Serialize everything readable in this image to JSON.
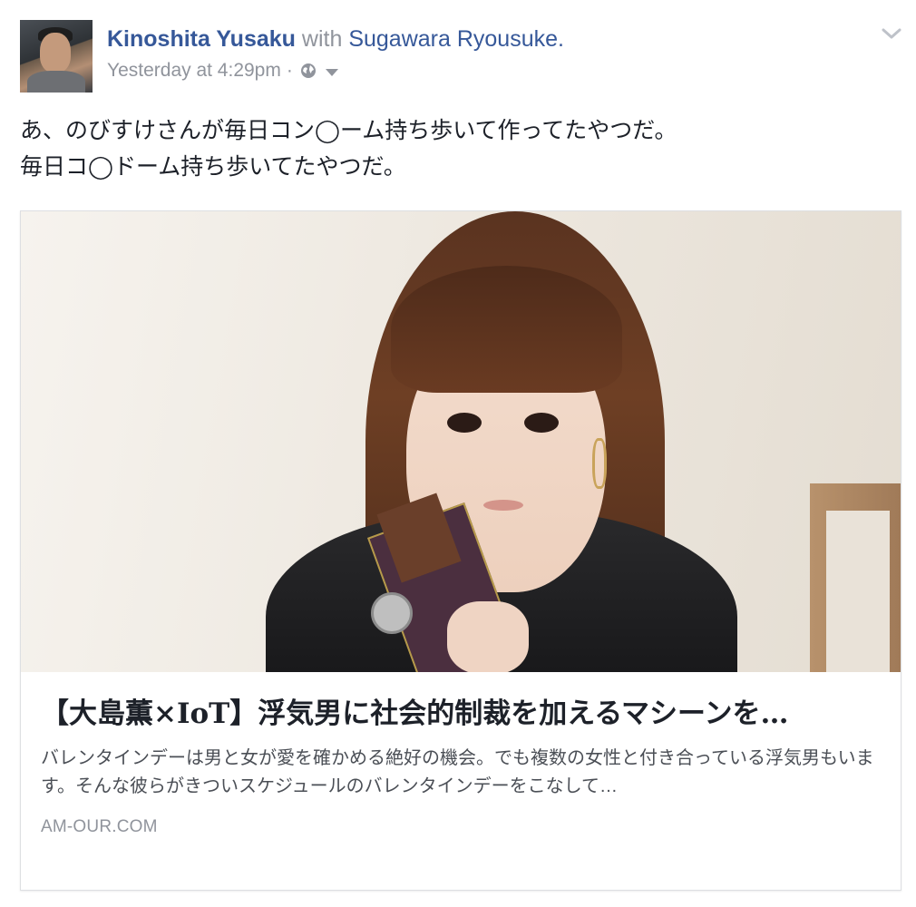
{
  "post": {
    "author": "Kinoshita Yusaku",
    "with_word": "with",
    "tagged": "Sugawara Ryousuke.",
    "timestamp": "Yesterday at 4:29pm",
    "separator": "·",
    "icons": {
      "audience": "globe-icon",
      "privacy_menu": "caret-down-icon",
      "options": "chevron-down-icon"
    },
    "message_lines": [
      "あ、のびすけさんが毎日コン◯ーム持ち歩いて作ってたやつだ。",
      "毎日コ◯ドーム持ち歩いてたやつだ。"
    ]
  },
  "link_card": {
    "title": "【大島薫×IoT】浮気男に社会的制裁を加えるマシーンを…",
    "description": "バレンタインデーは男と女が愛を確かめる絶好の機会。でも複数の女性と付き合っている浮気男もいます。そんな彼らがきついスケジュールのバレンタインデーをこなして…",
    "domain": "AM-OUR.COM"
  },
  "colors": {
    "link": "#365899",
    "meta": "#90949c",
    "text": "#1d2129",
    "border": "#dddfe2"
  }
}
